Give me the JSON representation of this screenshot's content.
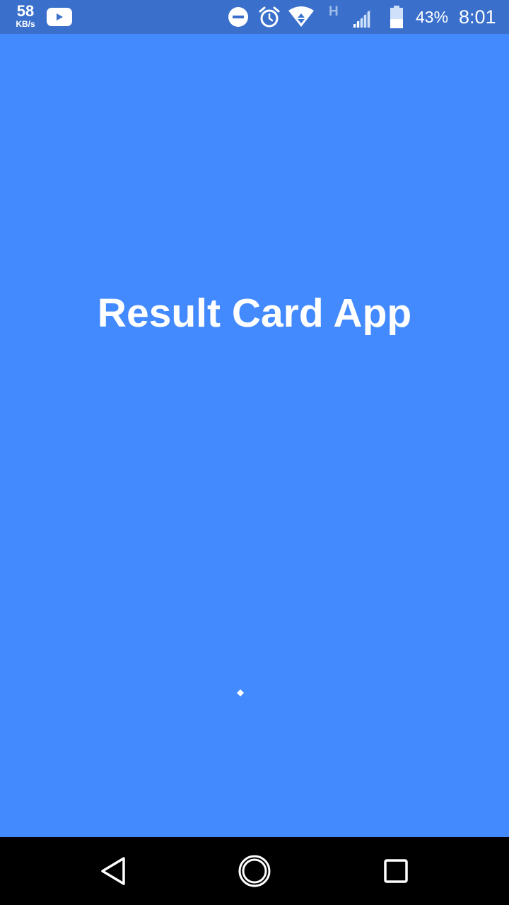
{
  "status_bar": {
    "net_speed_value": "58",
    "net_speed_unit": "KB/s",
    "network_type": "H",
    "battery": "43%",
    "time": "8:01",
    "icons": [
      "youtube-icon",
      "do-not-disturb-icon",
      "alarm-icon",
      "wifi-icon",
      "signal-icon",
      "battery-icon"
    ]
  },
  "main": {
    "title": "Result Card App"
  },
  "nav_bar": {
    "icons": [
      "back-icon",
      "home-icon",
      "recents-icon"
    ]
  },
  "colors": {
    "background": "#448aff",
    "status_bar": "#3a70cc",
    "text": "#ffffff",
    "nav_bar": "#000000"
  }
}
